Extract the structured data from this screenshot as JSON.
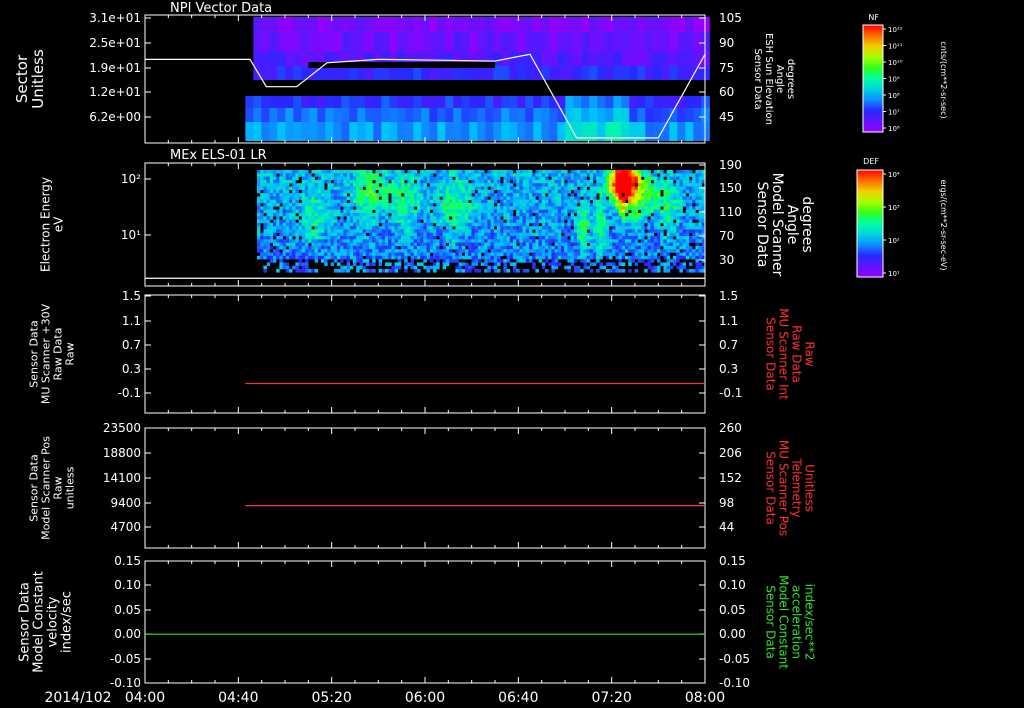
{
  "date_label": "2014/102",
  "time_axis": {
    "start": "04:00",
    "end": "08:00",
    "tick_labels": [
      "04:00",
      "04:40",
      "05:20",
      "06:00",
      "06:40",
      "07:20",
      "08:00"
    ]
  },
  "chart_data": [
    {
      "type": "heatmap",
      "title": "NPI Vector Data",
      "ylabel": "Sector\nUnitless",
      "yticks": [
        "3.1e+01",
        "2.5e+01",
        "1.9e+01",
        "1.2e+01",
        "6.2e+00"
      ],
      "y2label": "Sensor Data\nESH Sun Elevation\nAngle\ndegrees",
      "y2ticks": [
        "105",
        "90",
        "75",
        "60",
        "45"
      ],
      "colorbar": {
        "label": "NF",
        "units": "cnts/(cm**2-sr-sec)",
        "ticks": [
          "10¹²",
          "10¹¹",
          "10¹⁰",
          "10⁹",
          "10⁸",
          "10⁷",
          "10⁶"
        ]
      },
      "overlay_series": {
        "unit": "degrees",
        "ylim": [
          30,
          105
        ],
        "points": [
          [
            "04:00",
            79
          ],
          [
            "04:45",
            79
          ],
          [
            "04:52",
            63
          ],
          [
            "05:05",
            63
          ],
          [
            "05:18",
            77
          ],
          [
            "05:40",
            79
          ],
          [
            "06:30",
            78
          ],
          [
            "06:45",
            82
          ],
          [
            "07:05",
            33
          ],
          [
            "07:40",
            33
          ],
          [
            "08:00",
            82
          ]
        ]
      }
    },
    {
      "type": "heatmap",
      "title": "MEx ELS-01 LR",
      "ylabel": "Electron Energy\neV",
      "yticks": [
        "10²",
        "10¹"
      ],
      "y2label": "Sensor Data\nModel Scanner\nAngle\ndegrees",
      "y2ticks": [
        "190",
        "150",
        "110",
        "70",
        "30"
      ],
      "colorbar": {
        "label": "DEF",
        "units": "ergs/(cm**2-sr-sec-eV)",
        "ticks": [
          "10⁴",
          "10³",
          "10²",
          "10¹"
        ]
      },
      "overlay_series": {
        "unit": "degrees",
        "ylim": [
          0,
          190
        ],
        "points": [
          [
            "04:00",
            12
          ],
          [
            "08:00",
            12
          ]
        ]
      }
    },
    {
      "type": "line",
      "ylabel": "Sensor Data\nMU Scanner +30V\nRaw Data\nRaw",
      "yticks": [
        "1.5",
        "1.1",
        "0.7",
        "0.3",
        "-0.1"
      ],
      "ylim": [
        -0.5,
        1.5
      ],
      "y2label": "Sensor Data\nMU Scanner Int\nRaw Data\nRaw",
      "y2ticks": [
        "1.5",
        "1.1",
        "0.7",
        "0.3",
        "-0.1"
      ],
      "series": [
        {
          "color": "#ff3030",
          "x": [
            "04:43",
            "08:00"
          ],
          "y": [
            0.0,
            0.0
          ]
        }
      ]
    },
    {
      "type": "line",
      "ylabel": "Sensor Data\nModel Scanner Pos\nRaw\nunitless",
      "yticks": [
        "23500",
        "18800",
        "14100",
        "9400",
        "4700"
      ],
      "ylim": [
        0,
        23500
      ],
      "y2label": "Sensor Data\nMU Scanner Pos\nTelemetry\nUnitless",
      "y2ticks": [
        "260",
        "206",
        "152",
        "98",
        "44"
      ],
      "series": [
        {
          "color": "#ff3030",
          "x": [
            "04:43",
            "08:00"
          ],
          "y": [
            8300,
            8300
          ]
        }
      ]
    },
    {
      "type": "line",
      "ylabel": "Sensor Data\nModel Constant\nvelocity\nindex/sec",
      "yticks": [
        "0.15",
        "0.10",
        "0.05",
        "0.00",
        "-0.05",
        "-0.10"
      ],
      "ylim": [
        -0.1,
        0.15
      ],
      "y2label": "Sensor Data\nModel Constant\nacceleration\nindex/sec**2",
      "y2ticks": [
        "0.15",
        "0.10",
        "0.05",
        "0.00",
        "-0.05",
        "-0.10"
      ],
      "series": [
        {
          "color": "#30e030",
          "x": [
            "04:00",
            "08:00"
          ],
          "y": [
            0.0,
            0.0
          ]
        }
      ]
    }
  ],
  "colors": {
    "left_label": "#ffffff",
    "panel3_right_label": "#ff3030",
    "panel4_right_label": "#ff3030",
    "panel5_right_label": "#30e030"
  }
}
